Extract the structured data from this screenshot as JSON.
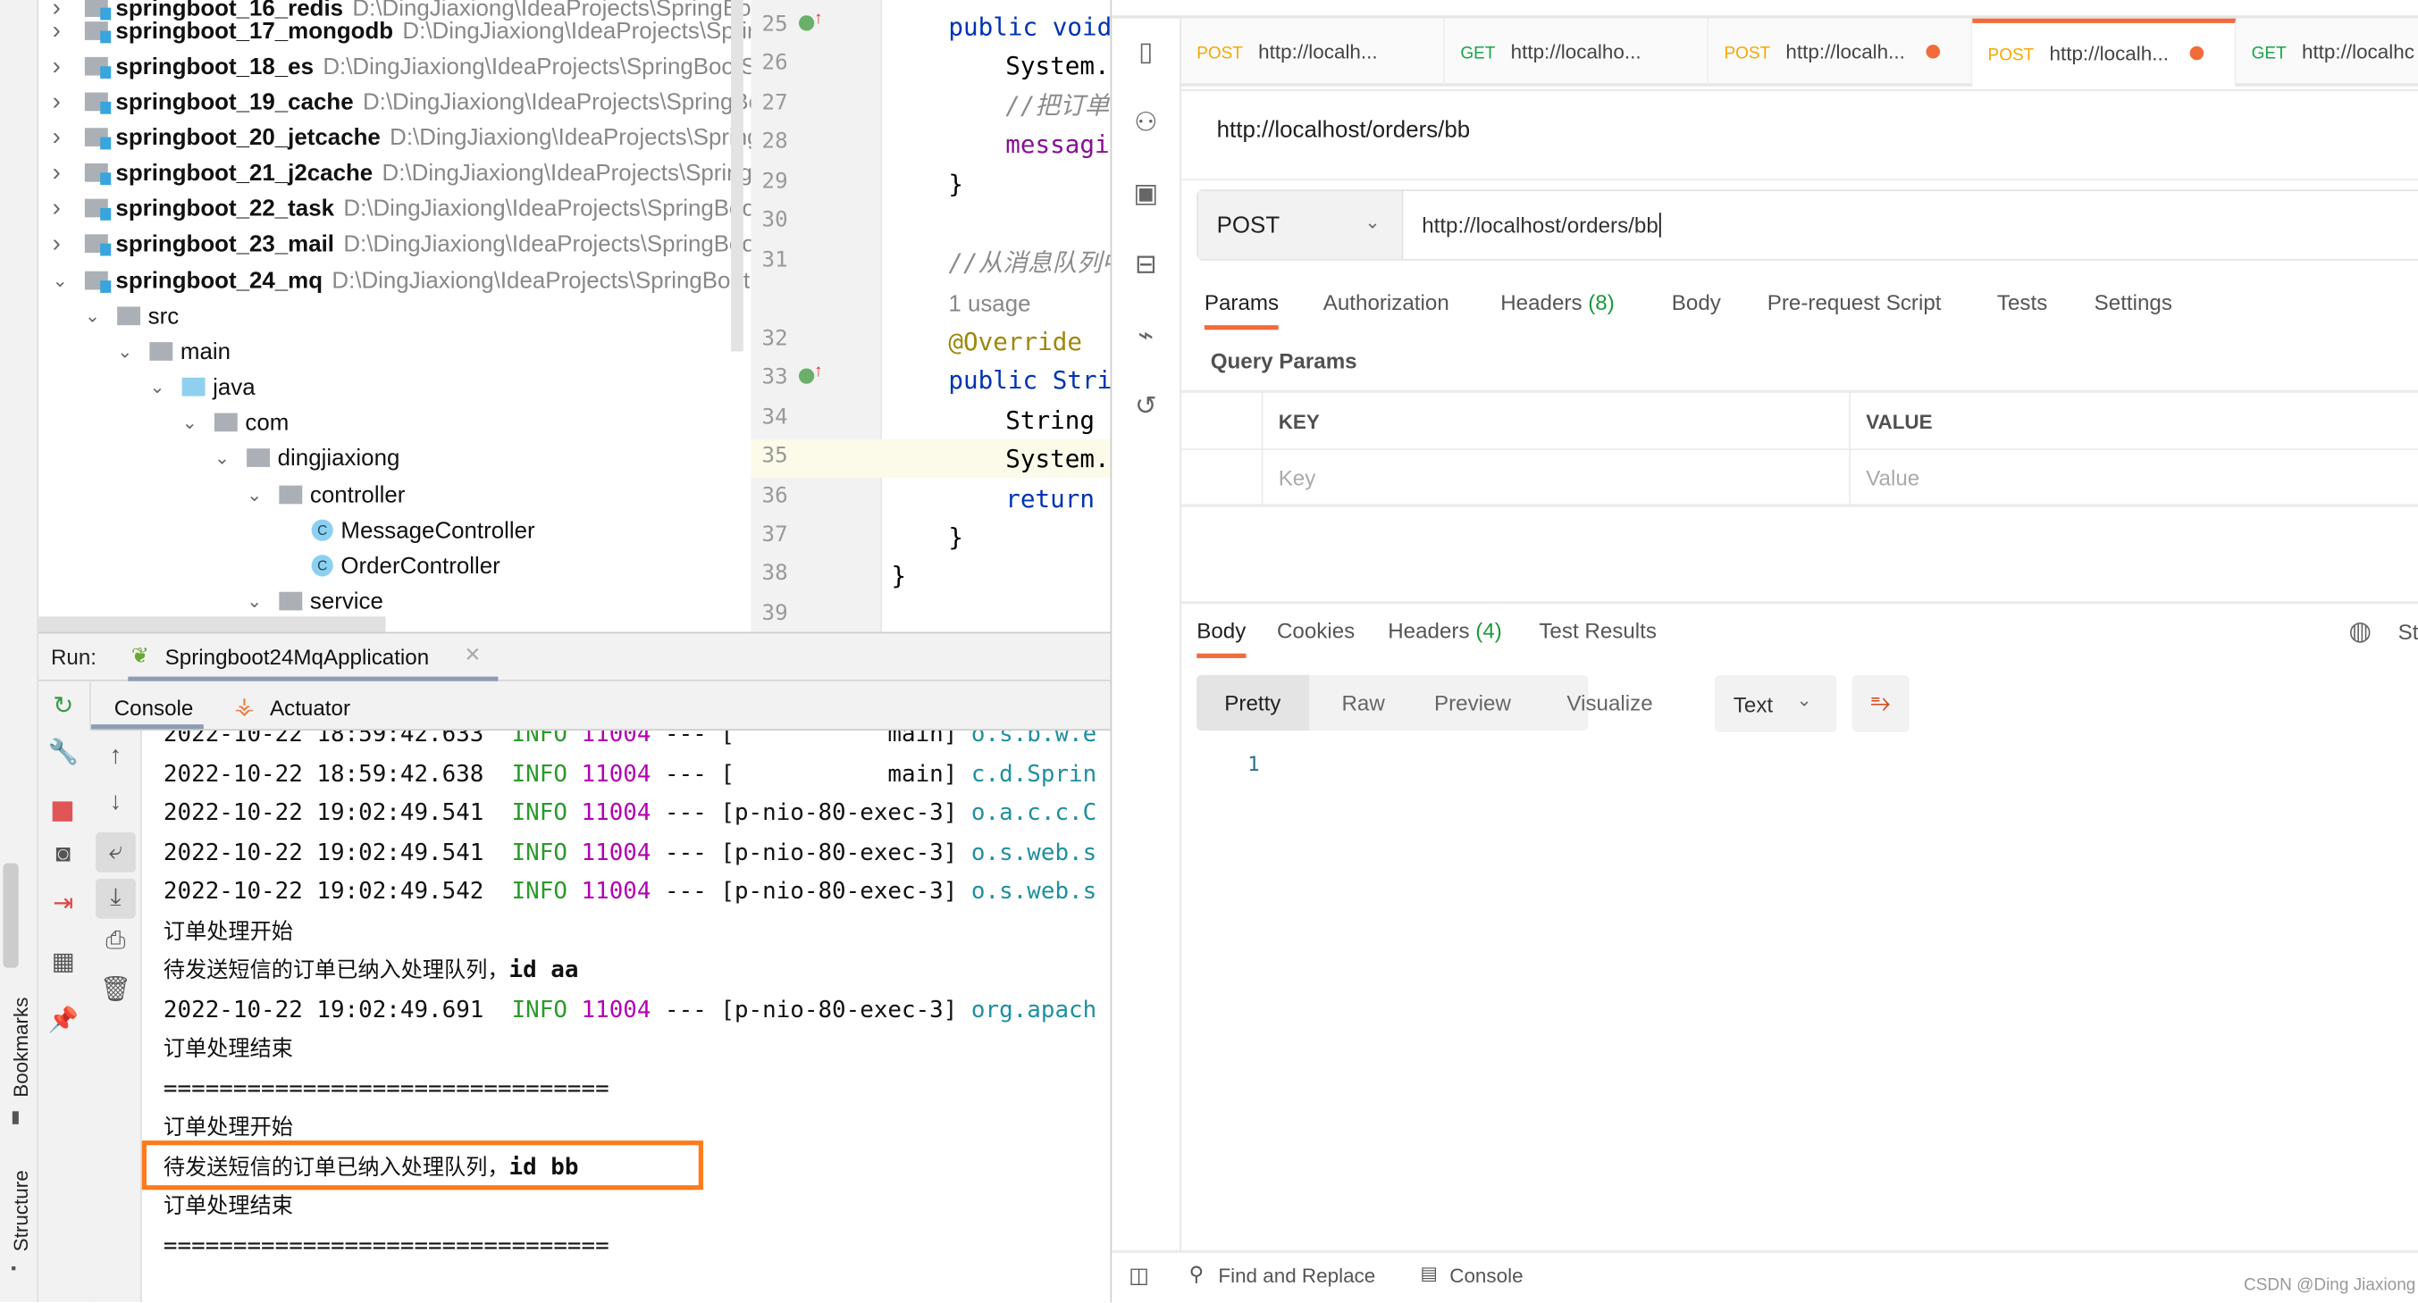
{
  "ide": {
    "left_strip": {
      "bookmarks": "Bookmarks",
      "structure": "Structure"
    },
    "tree": [
      {
        "level": 0,
        "name": "springboot_16_redis",
        "path": "D:\\DingJiaxiong\\IdeaProjects\\SpringBoo",
        "expanded": false,
        "type": "project"
      },
      {
        "level": 0,
        "name": "springboot_17_mongodb",
        "path": "D:\\DingJiaxiong\\IdeaProjects\\Sprin",
        "expanded": false,
        "type": "project"
      },
      {
        "level": 0,
        "name": "springboot_18_es",
        "path": "D:\\DingJiaxiong\\IdeaProjects\\SpringBootS",
        "expanded": false,
        "type": "project"
      },
      {
        "level": 0,
        "name": "springboot_19_cache",
        "path": "D:\\DingJiaxiong\\IdeaProjects\\SpringBo",
        "expanded": false,
        "type": "project"
      },
      {
        "level": 0,
        "name": "springboot_20_jetcache",
        "path": "D:\\DingJiaxiong\\IdeaProjects\\Spring",
        "expanded": false,
        "type": "project"
      },
      {
        "level": 0,
        "name": "springboot_21_j2cache",
        "path": "D:\\DingJiaxiong\\IdeaProjects\\SpringB",
        "expanded": false,
        "type": "project"
      },
      {
        "level": 0,
        "name": "springboot_22_task",
        "path": "D:\\DingJiaxiong\\IdeaProjects\\SpringBoo",
        "expanded": false,
        "type": "project"
      },
      {
        "level": 0,
        "name": "springboot_23_mail",
        "path": "D:\\DingJiaxiong\\IdeaProjects\\SpringBoo",
        "expanded": false,
        "type": "project"
      },
      {
        "level": 0,
        "name": "springboot_24_mq",
        "path": "D:\\DingJiaxiong\\IdeaProjects\\SpringBoot",
        "expanded": true,
        "type": "project"
      },
      {
        "level": 1,
        "name": "src",
        "expanded": true,
        "type": "folder"
      },
      {
        "level": 2,
        "name": "main",
        "expanded": true,
        "type": "folder"
      },
      {
        "level": 3,
        "name": "java",
        "expanded": true,
        "type": "source"
      },
      {
        "level": 4,
        "name": "com",
        "expanded": true,
        "type": "package"
      },
      {
        "level": 5,
        "name": "dingjiaxiong",
        "expanded": true,
        "type": "package"
      },
      {
        "level": 6,
        "name": "controller",
        "expanded": true,
        "type": "package"
      },
      {
        "level": 7,
        "name": "MessageController",
        "type": "class"
      },
      {
        "level": 7,
        "name": "OrderController",
        "type": "class"
      },
      {
        "level": 6,
        "name": "service",
        "expanded": true,
        "type": "package"
      }
    ],
    "editor": {
      "lines": [
        {
          "n": "25",
          "marker": true,
          "indent": 1,
          "parts": [
            {
              "t": "public void",
              "c": "kw"
            }
          ]
        },
        {
          "n": "26",
          "indent": 2,
          "parts": [
            {
              "t": "System.out",
              "c": ""
            }
          ]
        },
        {
          "n": "27",
          "indent": 2,
          "parts": [
            {
              "t": "//把订单处理",
              "c": "cm"
            }
          ]
        },
        {
          "n": "28",
          "indent": 2,
          "parts": [
            {
              "t": "messaging",
              "c": "pu"
            }
          ]
        },
        {
          "n": "29",
          "indent": 1,
          "parts": [
            {
              "t": "}",
              "c": ""
            }
          ]
        },
        {
          "n": "30",
          "indent": 1,
          "parts": []
        },
        {
          "n": "31",
          "indent": 1,
          "parts": [
            {
              "t": "//从消息队列中",
              "c": "cm"
            }
          ]
        },
        {
          "n": "",
          "indent": 1,
          "parts": [
            {
              "t": "1 usage",
              "c": "gr"
            }
          ]
        },
        {
          "n": "32",
          "indent": 1,
          "parts": [
            {
              "t": "@Override",
              "c": "an"
            }
          ]
        },
        {
          "n": "33",
          "marker": true,
          "indent": 1,
          "parts": [
            {
              "t": "public Strin",
              "c": "kw"
            }
          ]
        },
        {
          "n": "34",
          "indent": 2,
          "parts": [
            {
              "t": "String :",
              "c": ""
            }
          ]
        },
        {
          "n": "35",
          "indent": 2,
          "current": true,
          "parts": [
            {
              "t": "System.o",
              "c": ""
            }
          ]
        },
        {
          "n": "36",
          "indent": 2,
          "parts": [
            {
              "t": "return :",
              "c": "kw"
            }
          ]
        },
        {
          "n": "37",
          "indent": 1,
          "parts": [
            {
              "t": "}",
              "c": ""
            }
          ]
        },
        {
          "n": "38",
          "indent": 0,
          "parts": [
            {
              "t": "}",
              "c": ""
            }
          ]
        },
        {
          "n": "39",
          "indent": 0,
          "parts": []
        }
      ]
    },
    "run": {
      "label": "Run:",
      "config": "Springboot24MqApplication",
      "tabs": [
        "Console",
        "Actuator"
      ],
      "console": [
        {
          "date": "2022-10-22 18:59:42.633",
          "level": "INFO",
          "pid": "11004",
          "thread": "[           main]",
          "logger": "o.s.b.w.e"
        },
        {
          "date": "2022-10-22 18:59:42.638",
          "level": "INFO",
          "pid": "11004",
          "thread": "[           main]",
          "logger": "c.d.Sprin"
        },
        {
          "date": "2022-10-22 19:02:49.541",
          "level": "INFO",
          "pid": "11004",
          "thread": "[p-nio-80-exec-3]",
          "logger": "o.a.c.c.C"
        },
        {
          "date": "2022-10-22 19:02:49.541",
          "level": "INFO",
          "pid": "11004",
          "thread": "[p-nio-80-exec-3]",
          "logger": "o.s.web.s"
        },
        {
          "date": "2022-10-22 19:02:49.542",
          "level": "INFO",
          "pid": "11004",
          "thread": "[p-nio-80-exec-3]",
          "logger": "o.s.web.s"
        },
        {
          "zh": "订单处理开始"
        },
        {
          "zh": "待发送短信的订单已纳入处理队列，",
          "tail": "id aa"
        },
        {
          "date": "2022-10-22 19:02:49.691",
          "level": "INFO",
          "pid": "11004",
          "thread": "[p-nio-80-exec-3]",
          "logger": "org.apach"
        },
        {
          "zh": "订单处理结束"
        },
        {
          "text": "================================"
        },
        {
          "zh": "订单处理开始"
        },
        {
          "zh": "待发送短信的订单已纳入处理队列，",
          "tail": "id bb"
        },
        {
          "zh": "订单处理结束"
        },
        {
          "text": "================================"
        }
      ],
      "highlight_color": "#ff7a1a"
    }
  },
  "postman": {
    "tabs": [
      {
        "method": "POST",
        "url": "http://localh...",
        "unsaved": false
      },
      {
        "method": "GET",
        "url": "http://localho...",
        "unsaved": false
      },
      {
        "method": "POST",
        "url": "http://localh...",
        "unsaved": true
      },
      {
        "method": "POST",
        "url": "http://localh...",
        "unsaved": true,
        "active": true
      },
      {
        "method": "GET",
        "url": "http://localhc",
        "unsaved": false
      }
    ],
    "title": "http://localhost/orders/bb",
    "method": "POST",
    "url": "http://localhost/orders/bb",
    "req_tabs": [
      {
        "label": "Params",
        "selected": true
      },
      {
        "label": "Authorization"
      },
      {
        "label": "Headers",
        "count": "(8)"
      },
      {
        "label": "Body"
      },
      {
        "label": "Pre-request Script"
      },
      {
        "label": "Tests"
      },
      {
        "label": "Settings"
      }
    ],
    "query_params": {
      "title": "Query Params",
      "key_header": "KEY",
      "value_header": "VALUE",
      "key_placeholder": "Key",
      "value_placeholder": "Value"
    },
    "resp_tabs": [
      {
        "label": "Body",
        "selected": true
      },
      {
        "label": "Cookies"
      },
      {
        "label": "Headers",
        "count": "(4)"
      },
      {
        "label": "Test Results"
      }
    ],
    "resp_status_partial": "St",
    "view_modes": [
      "Pretty",
      "Raw",
      "Preview",
      "Visualize"
    ],
    "selected_view": "Pretty",
    "format": "Text",
    "body_line_number": "1",
    "footer": {
      "find": "Find and Replace",
      "console": "Console"
    },
    "watermark": "CSDN @Ding Jiaxiong",
    "accent": "#f26b3a"
  }
}
